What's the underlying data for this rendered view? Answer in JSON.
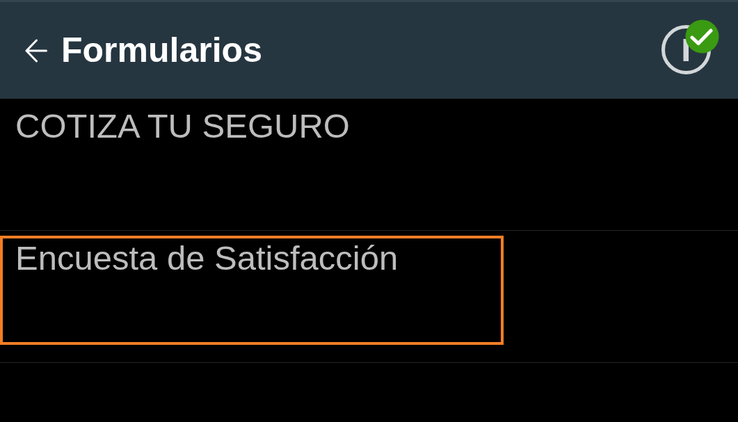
{
  "header": {
    "title": "Formularios"
  },
  "forms": [
    {
      "title": "COTIZA TU SEGURO",
      "highlighted": false
    },
    {
      "title": "Encuesta de Satisfacción",
      "highlighted": true
    }
  ]
}
